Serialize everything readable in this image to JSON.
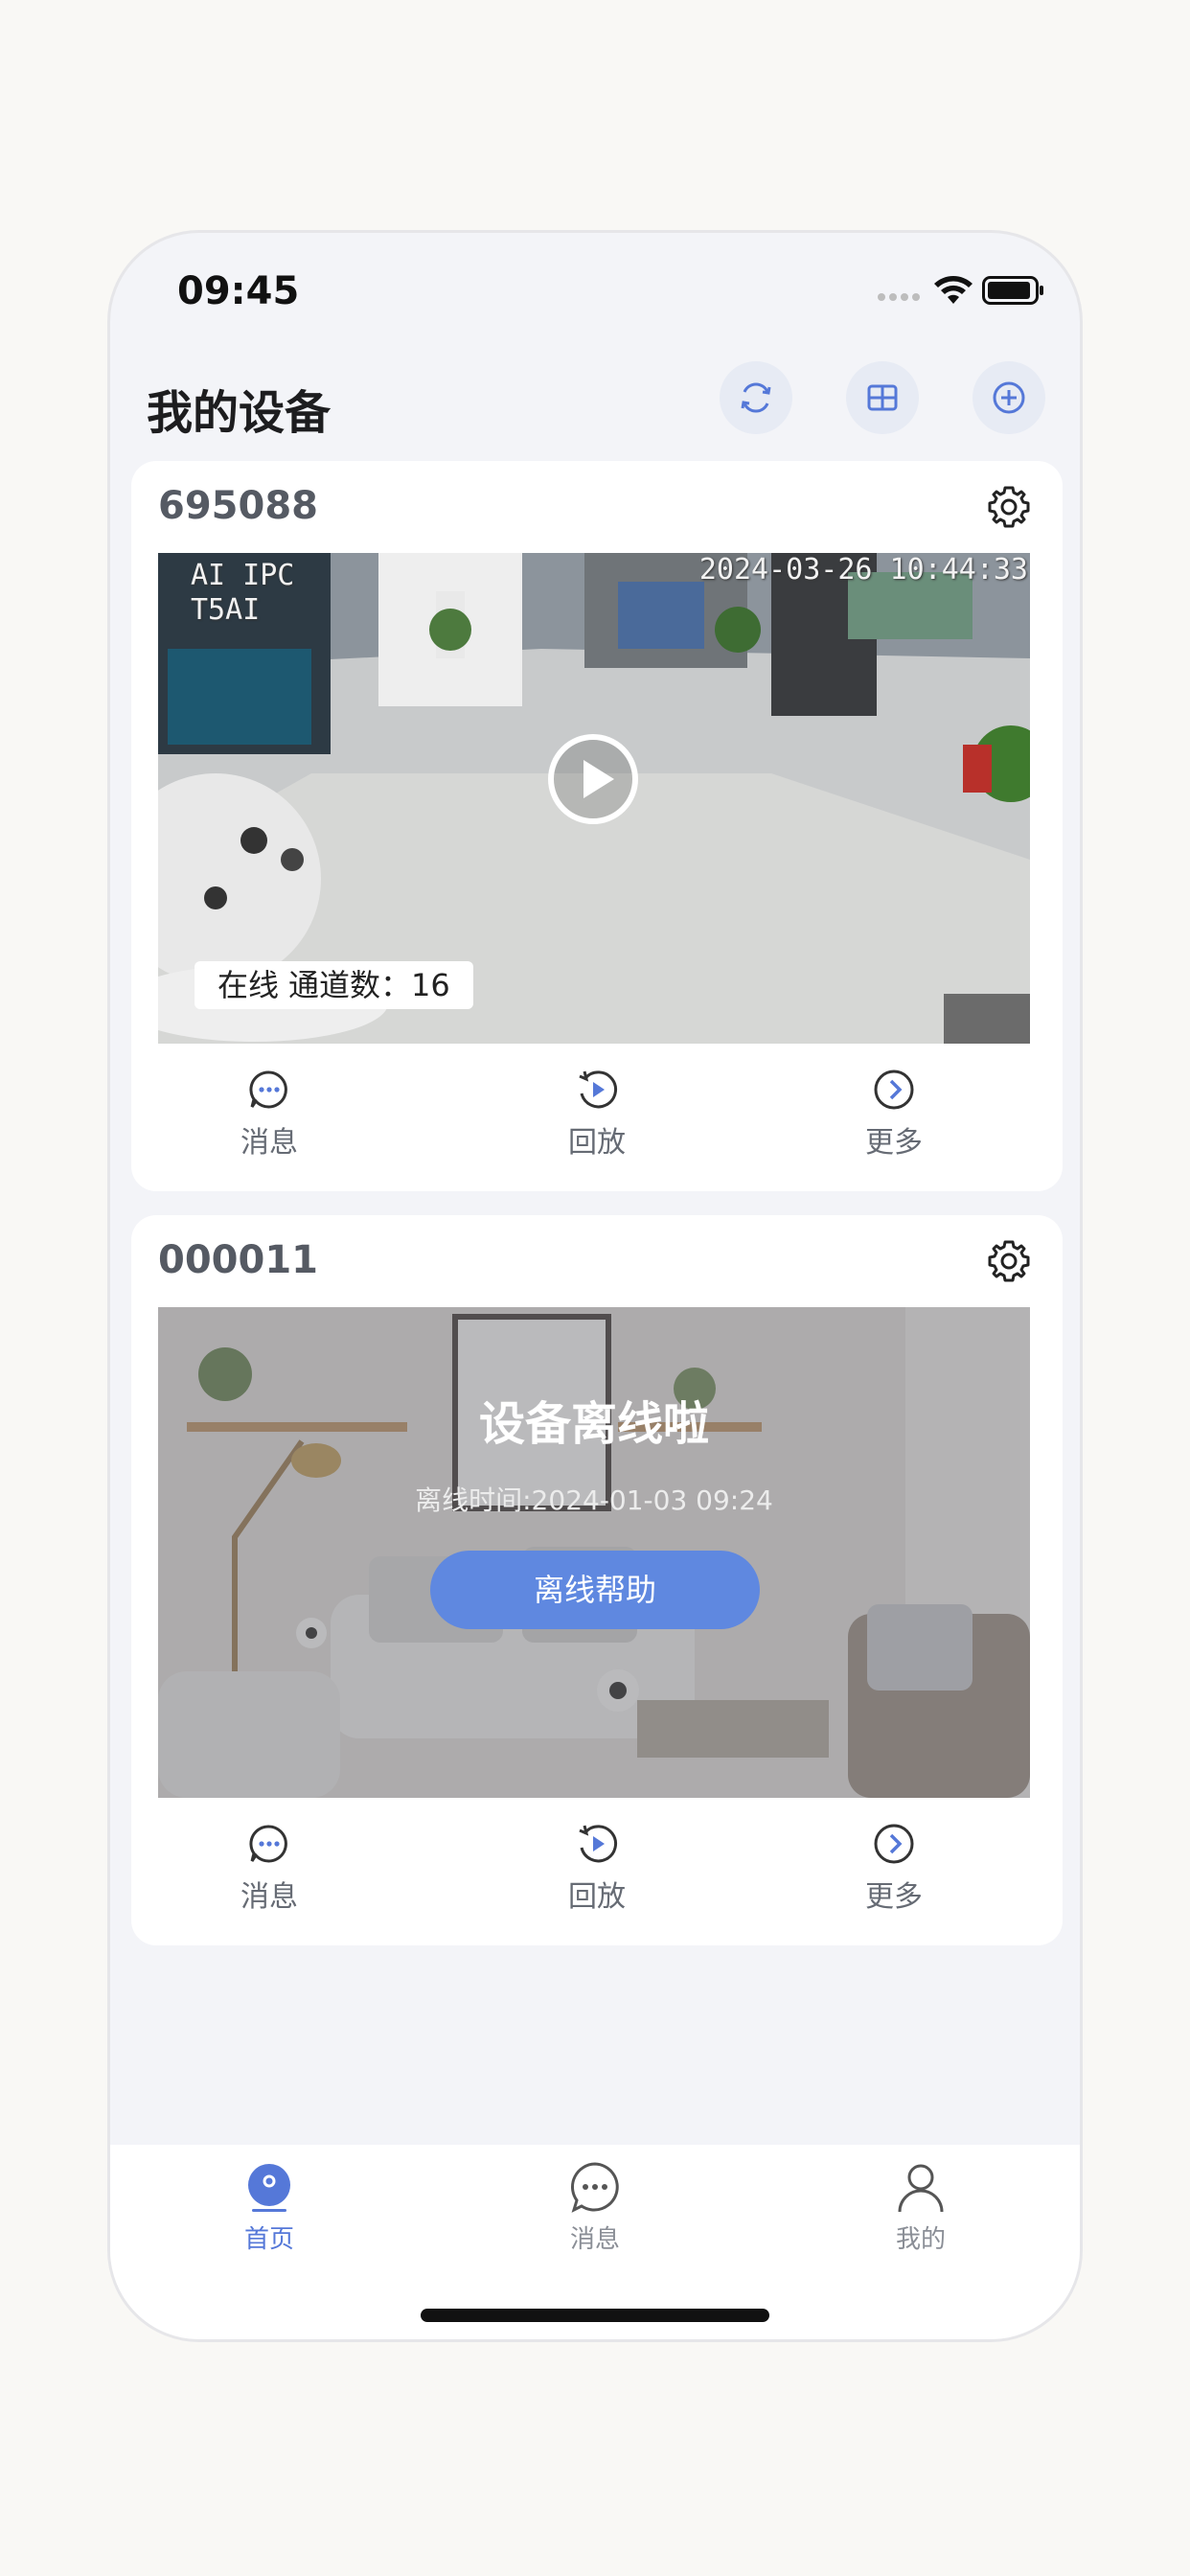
{
  "status_bar": {
    "time": "09:45"
  },
  "header": {
    "title": "我的设备"
  },
  "colors": {
    "accent": "#5f88e0",
    "tab_active": "#5578d8",
    "background": "#f3f4f8"
  },
  "devices": [
    {
      "name": "695088",
      "online": true,
      "osd_model": "AI IPC\nT5AI",
      "osd_timestamp": "2024-03-26 10:44:33",
      "status_label": "在线",
      "channel_label": "通道数：16",
      "actions": [
        "消息",
        "回放",
        "更多"
      ]
    },
    {
      "name": "000011",
      "online": false,
      "offline_title": "设备离线啦",
      "offline_time": "离线时间:2024-01-03 09:24",
      "help_button": "离线帮助",
      "actions": [
        "消息",
        "回放",
        "更多"
      ]
    }
  ],
  "tabbar": [
    {
      "label": "首页",
      "icon": "home-camera-icon",
      "active": true
    },
    {
      "label": "消息",
      "icon": "chat-bubble-icon",
      "active": false
    },
    {
      "label": "我的",
      "icon": "person-icon",
      "active": false
    }
  ]
}
